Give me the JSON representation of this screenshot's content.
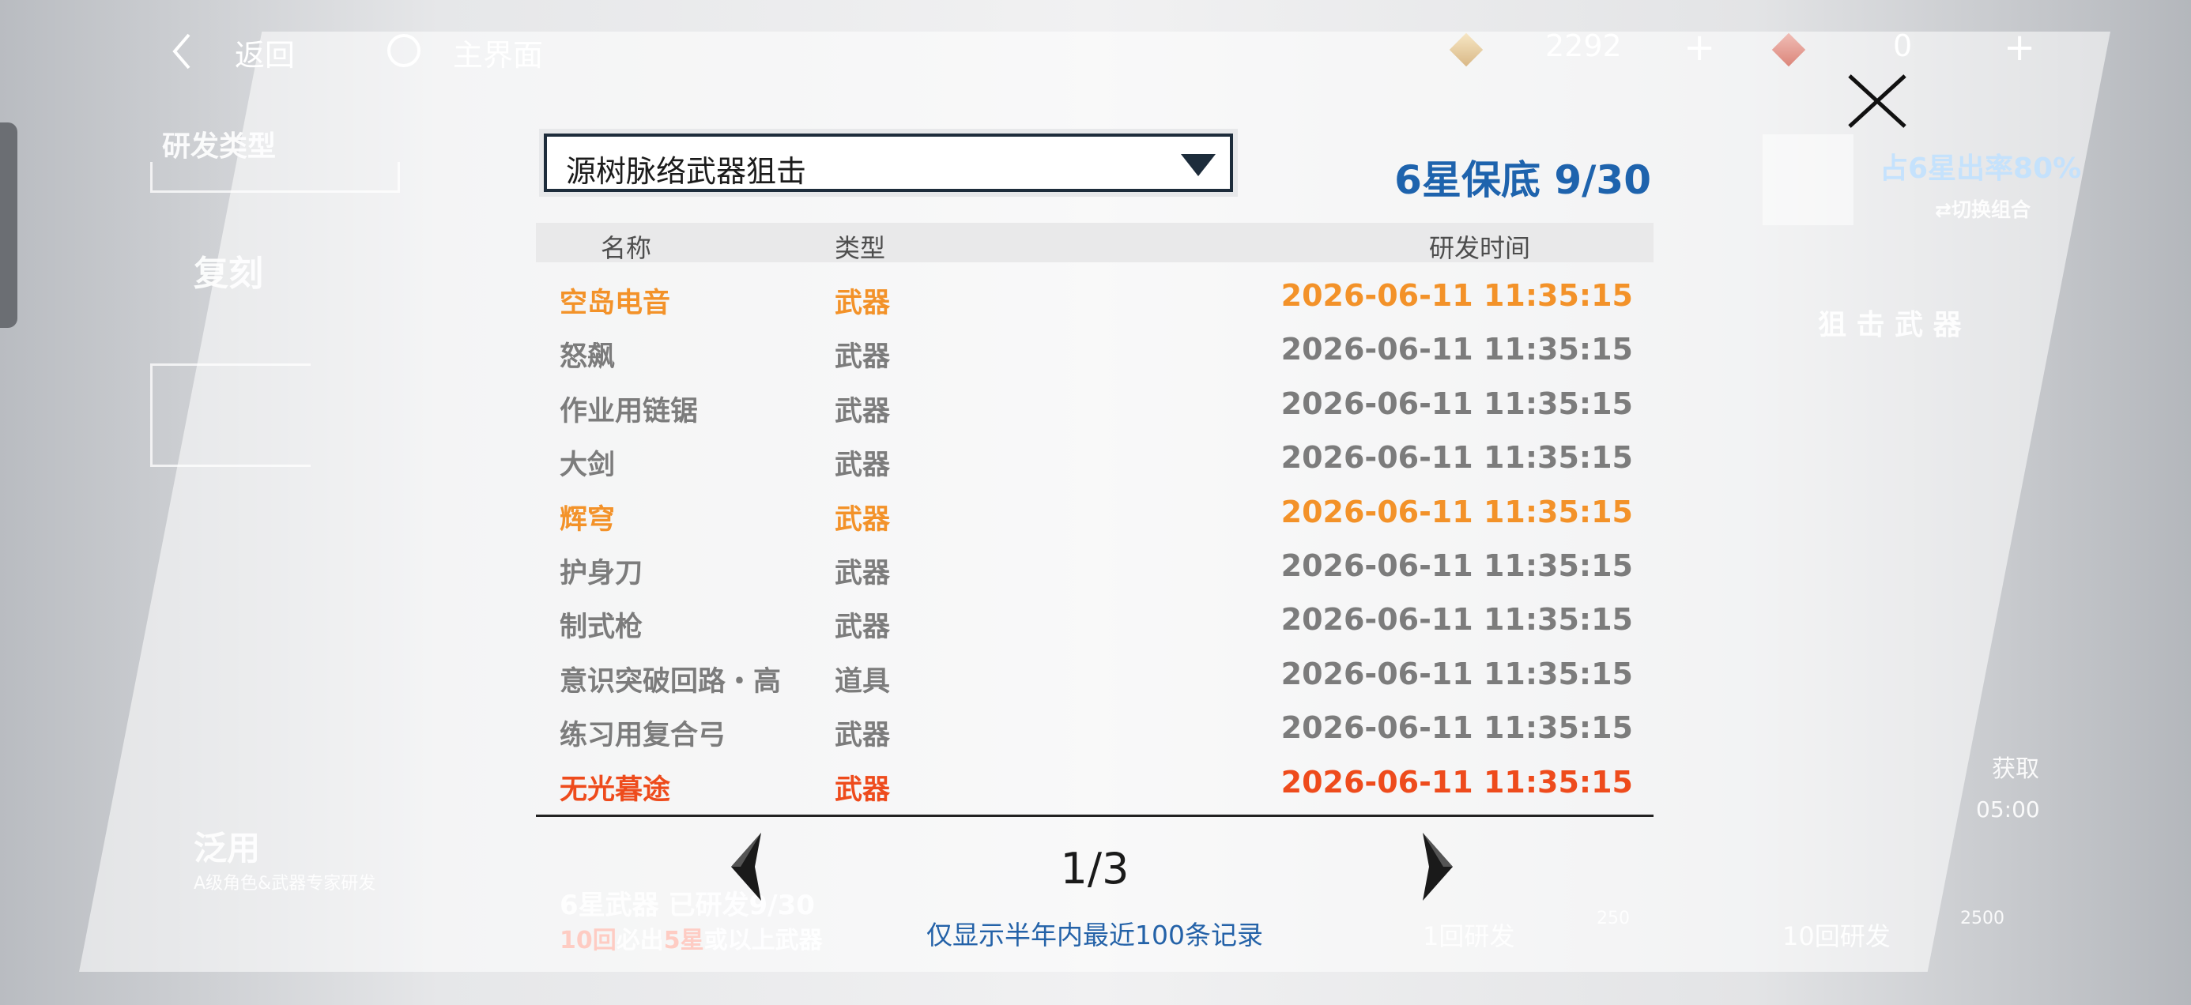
{
  "header": {
    "back_label": "返回",
    "home_label": "主界面",
    "currency_1": "2292",
    "currency_2": "0",
    "plus": "+"
  },
  "background": {
    "category_title": "研发类型",
    "tab_1": "复刻",
    "tab_2": "泛用",
    "tab_2_sub": "A级角色&武器专家研发",
    "rate_text": "占6星出率80%",
    "switch_label": "⇄切换组合",
    "weapon_type": "狙 击 武 器",
    "bottom_info_prefix": "10回",
    "bottom_info_mid": "必出",
    "bottom_info_star": "5星",
    "bottom_info_suffix": "或以上武器",
    "bottom_info_top": "6星武器 已研发9/30",
    "pull_1": "1回研发",
    "pull_10": "10回研发",
    "cost_1": "250",
    "cost_10": "2500",
    "time_label": "获取",
    "time_value": "05:00"
  },
  "modal": {
    "dropdown_value": "源树脉络武器狙击",
    "pity_text": "6星保底 9/30",
    "columns": {
      "name": "名称",
      "type": "类型",
      "time": "研发时间"
    },
    "rows": [
      {
        "name": "空岛电音",
        "type": "武器",
        "time": "2026-06-11 11:35:15",
        "rarity": "5"
      },
      {
        "name": "怒飙",
        "type": "武器",
        "time": "2026-06-11 11:35:15",
        "rarity": "3"
      },
      {
        "name": "作业用链锯",
        "type": "武器",
        "time": "2026-06-11 11:35:15",
        "rarity": "3"
      },
      {
        "name": "大剑",
        "type": "武器",
        "time": "2026-06-11 11:35:15",
        "rarity": "3"
      },
      {
        "name": "辉穹",
        "type": "武器",
        "time": "2026-06-11 11:35:15",
        "rarity": "5"
      },
      {
        "name": "护身刀",
        "type": "武器",
        "time": "2026-06-11 11:35:15",
        "rarity": "3"
      },
      {
        "name": "制式枪",
        "type": "武器",
        "time": "2026-06-11 11:35:15",
        "rarity": "3"
      },
      {
        "name": "意识突破回路・高",
        "type": "道具",
        "time": "2026-06-11 11:35:15",
        "rarity": "3"
      },
      {
        "name": "练习用复合弓",
        "type": "武器",
        "time": "2026-06-11 11:35:15",
        "rarity": "3"
      },
      {
        "name": "无光暮途",
        "type": "武器",
        "time": "2026-06-11 11:35:15",
        "rarity": "6"
      }
    ],
    "page": "1/3",
    "note": "仅显示半年内最近100条记录"
  },
  "colors": {
    "rarity_6": "#ee4b1c",
    "rarity_5": "#f39229",
    "rarity_3": "#7c7c7c",
    "accent_blue": "#1e63ad"
  }
}
